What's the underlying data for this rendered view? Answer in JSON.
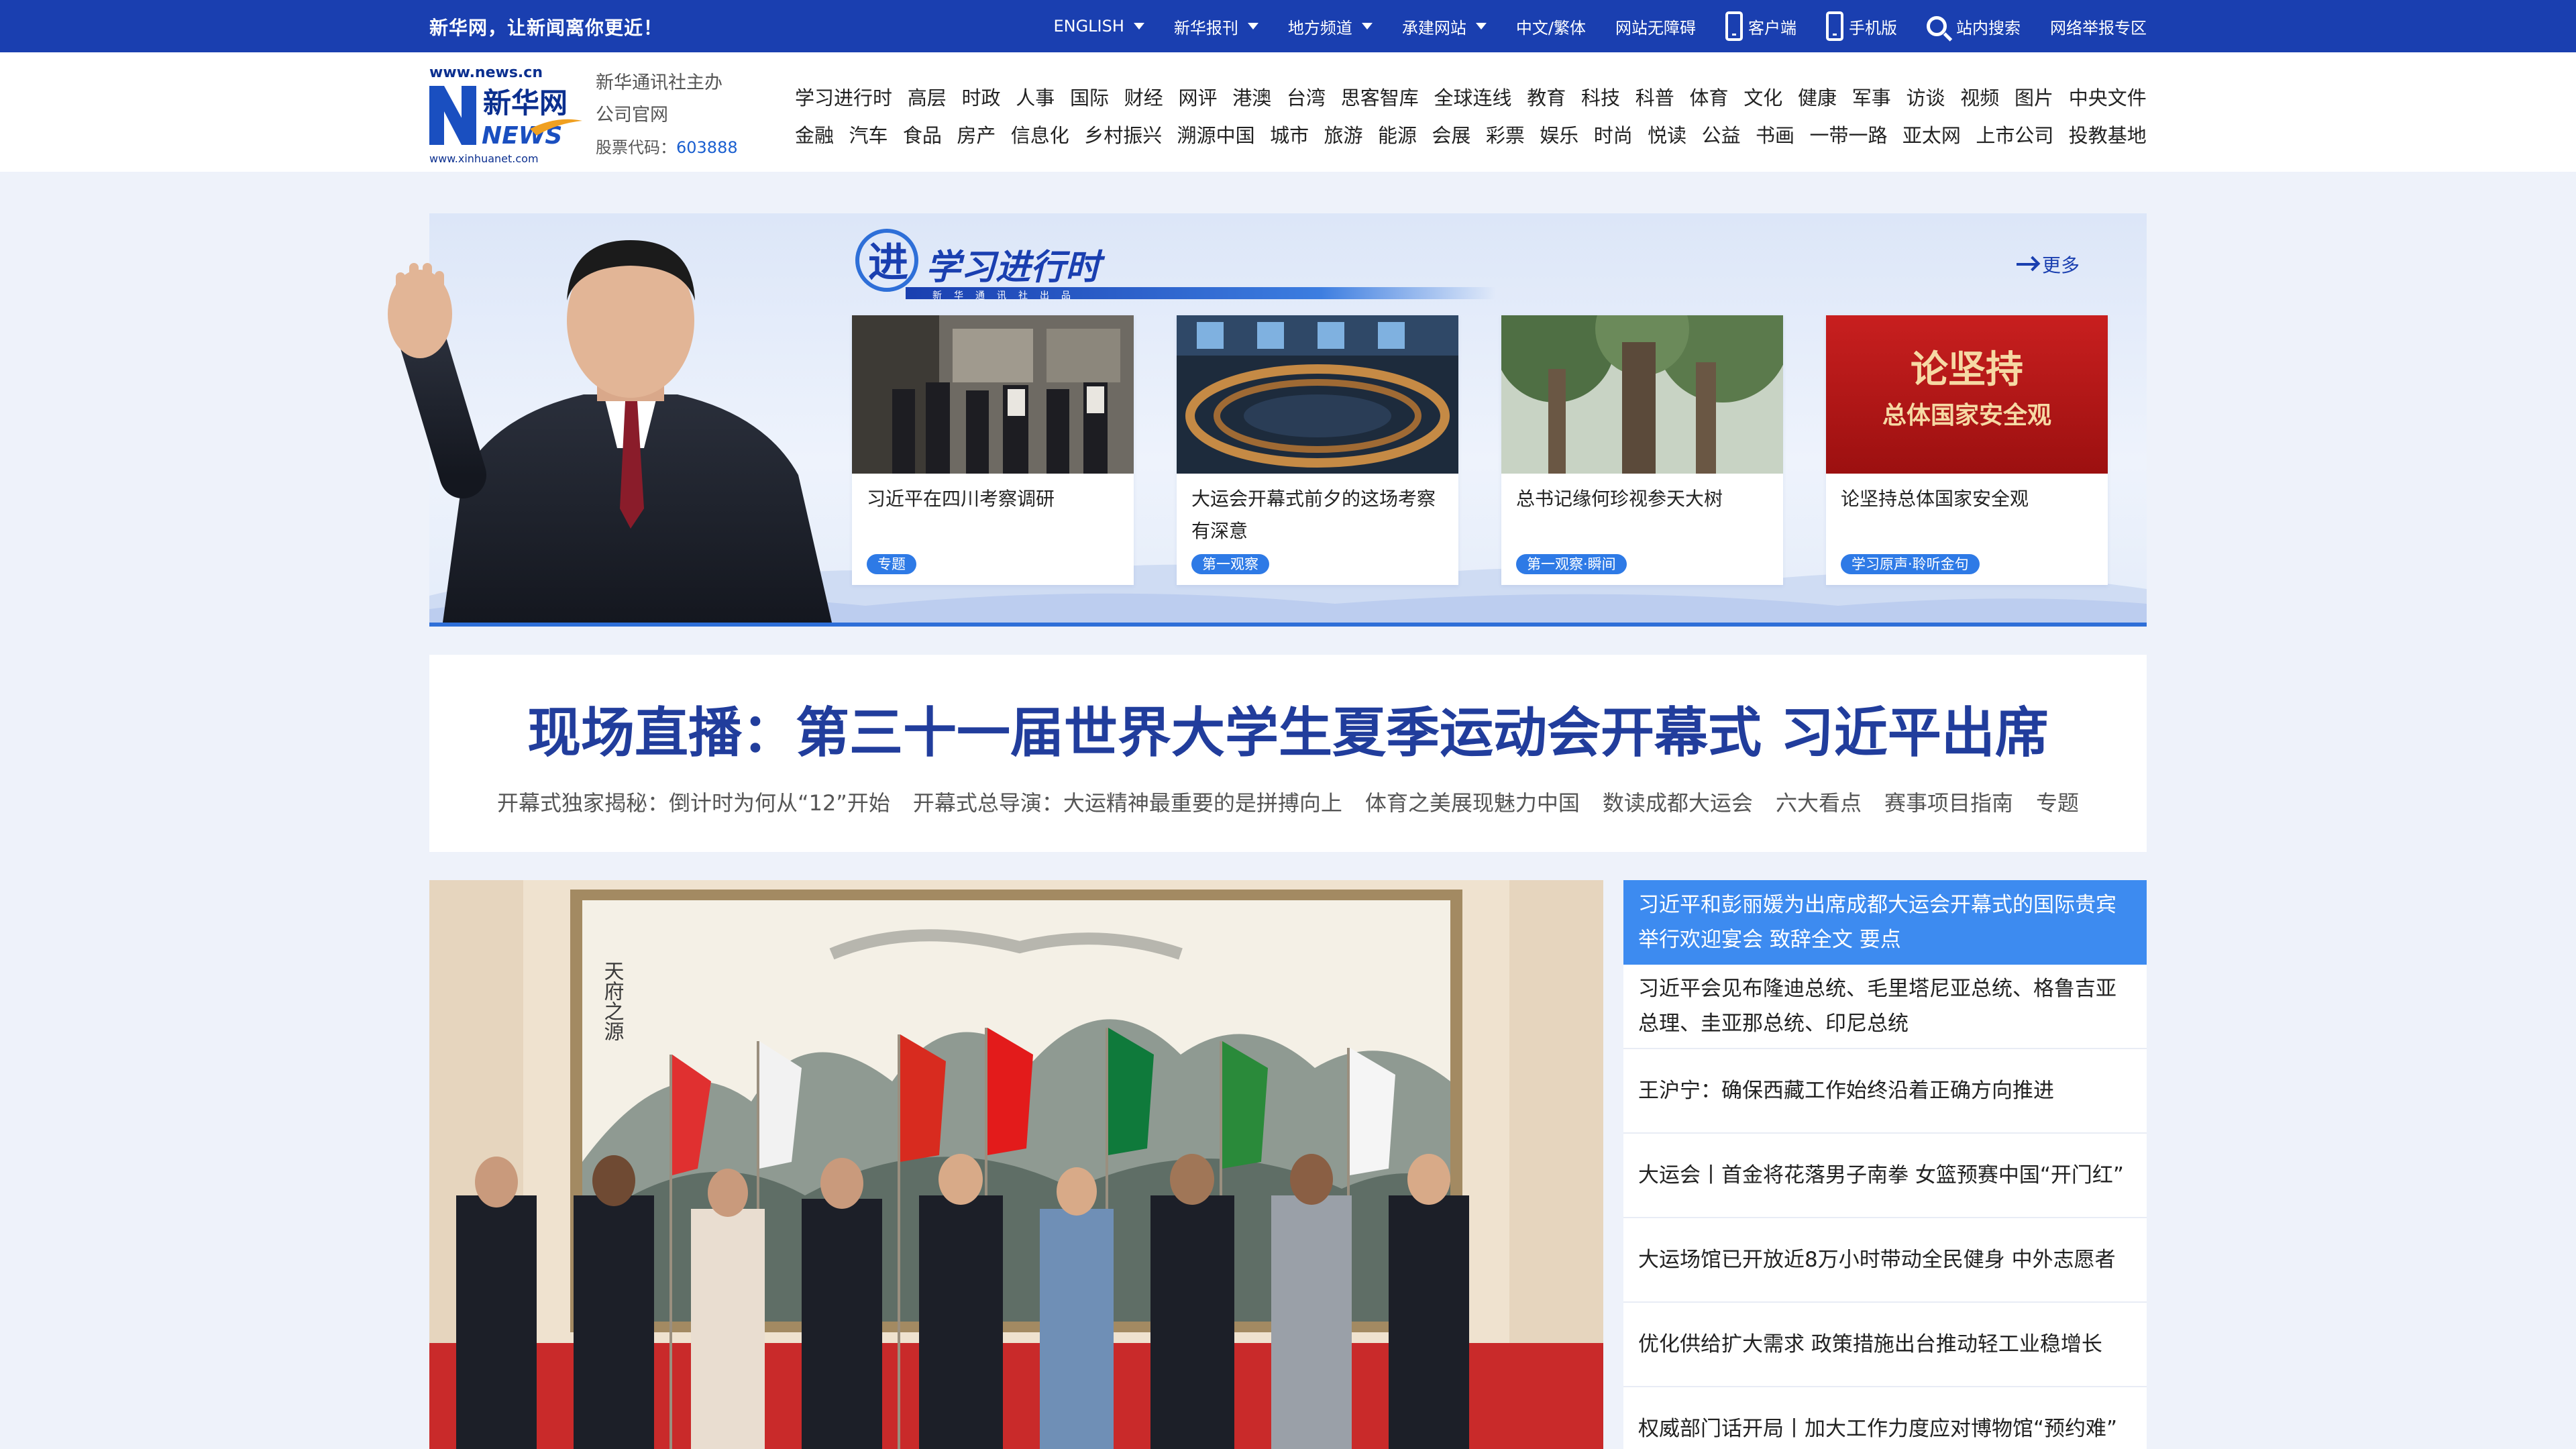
{
  "topbar": {
    "slogan": "新华网，让新闻离你更近！",
    "nav": [
      {
        "label": "ENGLISH",
        "dropdown": true
      },
      {
        "label": "新华报刊",
        "dropdown": true
      },
      {
        "label": "地方频道",
        "dropdown": true
      },
      {
        "label": "承建网站",
        "dropdown": true
      },
      {
        "label": "中文/繁体"
      },
      {
        "label": "网站无障碍"
      },
      {
        "label": "客户端",
        "icon": "phone-icon"
      },
      {
        "label": "手机版",
        "icon": "mobile-icon"
      },
      {
        "label": "站内搜索",
        "icon": "search-icon"
      },
      {
        "label": "网络举报专区"
      }
    ]
  },
  "header": {
    "logo": {
      "url_top": "www.news.cn",
      "url_bottom": "www.xinhuanet.com",
      "brand": "新华网",
      "brand_en": "NEWS"
    },
    "org_line1": "新华通讯社主办",
    "org_line2": "公司官网",
    "stock_label": "股票代码：",
    "stock_code": "603888",
    "nav_row1": [
      "学习进行时",
      "高层",
      "时政",
      "人事",
      "国际",
      "财经",
      "网评",
      "港澳",
      "台湾",
      "思客智库",
      "全球连线",
      "教育",
      "科技",
      "科普",
      "体育",
      "文化",
      "健康",
      "军事",
      "访谈",
      "视频",
      "图片",
      "中央文件"
    ],
    "nav_row2": [
      "金融",
      "汽车",
      "食品",
      "房产",
      "信息化",
      "乡村振兴",
      "溯源中国",
      "城市",
      "旅游",
      "能源",
      "会展",
      "彩票",
      "娱乐",
      "时尚",
      "悦读",
      "公益",
      "书画",
      "一带一路",
      "亚太网",
      "上市公司",
      "投教基地"
    ]
  },
  "banner": {
    "title": "学习进行时",
    "subtitle": "新华通讯社出品",
    "more_label": "更多",
    "cards": [
      {
        "text": "习近平在四川考察调研",
        "tag": "专题"
      },
      {
        "text": "大运会开幕式前夕的这场考察有深意",
        "tag": "第一观察"
      },
      {
        "text": "总书记缘何珍视参天大树",
        "tag": "第一观察·瞬间"
      },
      {
        "text": "论坚持总体国家安全观",
        "tag": "学习原声·聆听金句",
        "thumb_title": "论坚持",
        "thumb_sub": "总体国家安全观"
      }
    ]
  },
  "headline": {
    "title": "现场直播：第三十一届世界大学生夏季运动会开幕式 习近平出席",
    "links": [
      "开幕式独家揭秘：倒计时为何从“12”开始",
      "开幕式总导演：大运精神最重要的是拼搏向上",
      "体育之美展现魅力中国",
      "数读成都大运会",
      "六大看点",
      "赛事项目指南",
      "专题"
    ]
  },
  "newslist": [
    "习近平和彭丽媛为出席成都大运会开幕式的国际贵宾举行欢迎宴会 致辞全文 要点",
    "习近平会见布隆迪总统、毛里塔尼亚总统、格鲁吉亚总理、圭亚那总统、印尼总统",
    "王沪宁：确保西藏工作始终沿着正确方向推进",
    "大运会丨首金将花落男子南拳 女篮预赛中国“开门红”",
    "大运场馆已开放近8万小时带动全民健身 中外志愿者",
    "优化供给扩大需求 政策措施出台推动轻工业稳增长",
    "权威部门话开局丨加大工作力度应对博物馆“预约难”"
  ],
  "painting_inscription": "天府之源",
  "colors": {
    "brand_blue": "#1a3fb0",
    "headline_blue": "#213d9c",
    "active_blue": "#3d8bf0",
    "tag_blue": "#2e7ae6"
  }
}
